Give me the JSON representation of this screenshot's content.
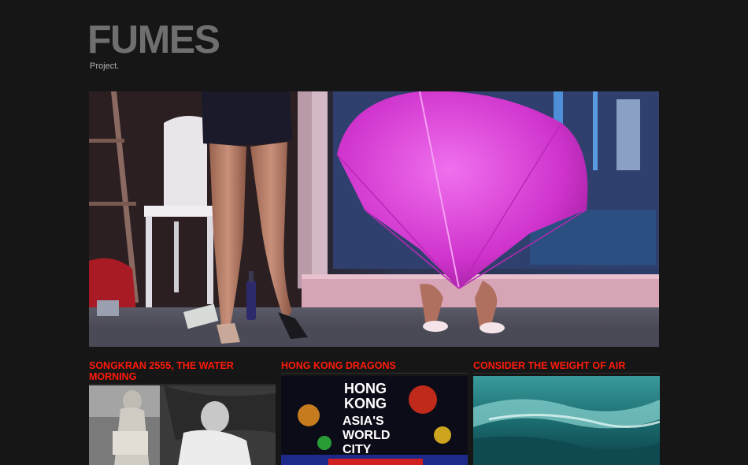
{
  "site": {
    "logo": "FUMES",
    "tagline": "Project."
  },
  "hero": {
    "alt": "Street scene with woman in high heels and person under pink umbrella"
  },
  "posts": [
    {
      "title": "SONGKRAN 2555, THE WATER MORNING"
    },
    {
      "title": "HONG KONG DRAGONS",
      "sign": [
        "HONG",
        "KONG",
        "ASIA'S",
        "WORLD",
        "CITY"
      ]
    },
    {
      "title": "CONSIDER THE WEIGHT OF AIR"
    }
  ],
  "colors": {
    "background": "#161616",
    "logo": "#6f6f6f",
    "accent": "#ff1a0a",
    "umbrella": "#d93ad6"
  }
}
